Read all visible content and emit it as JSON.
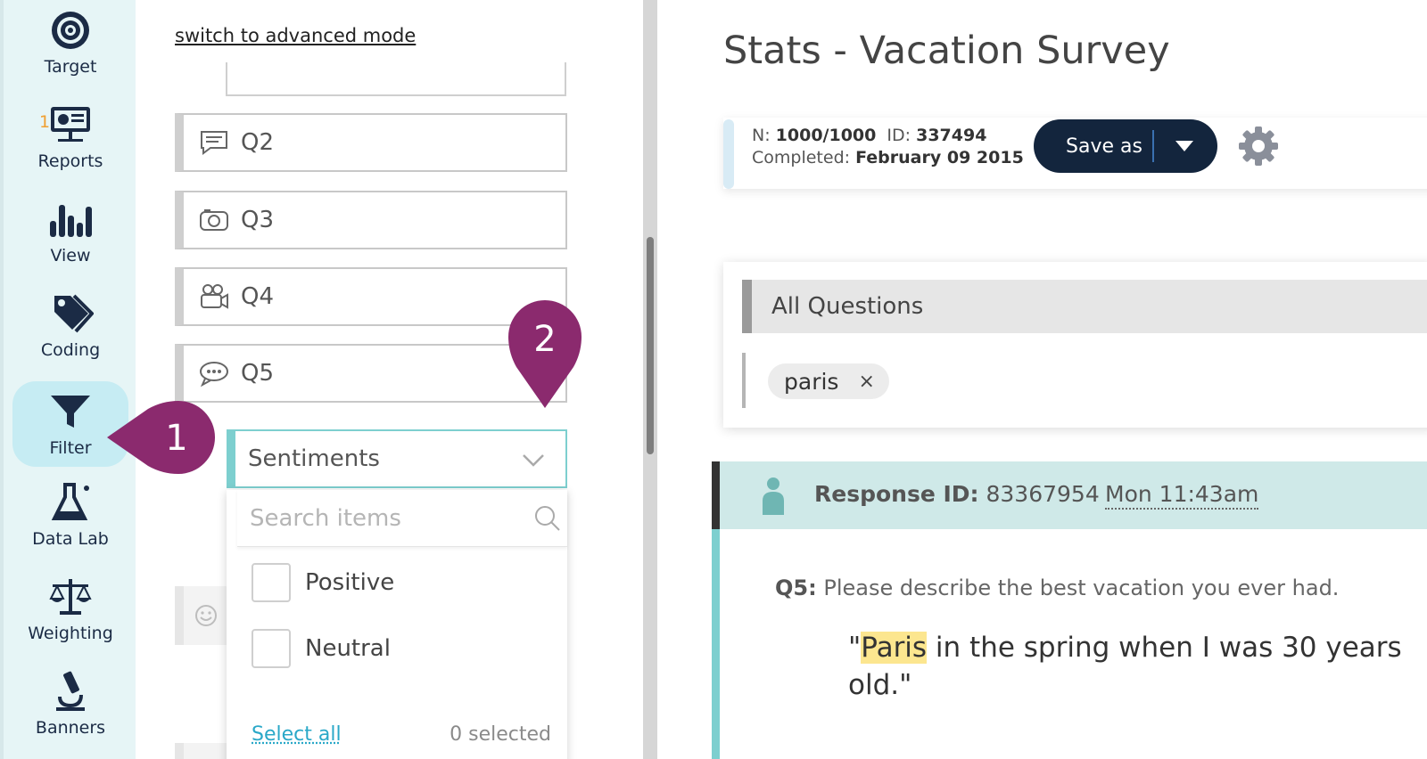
{
  "nav": {
    "items": [
      {
        "label": "Target",
        "icon": "target-icon"
      },
      {
        "label": "Reports",
        "icon": "presentation-board-icon",
        "badge": "1"
      },
      {
        "label": "View",
        "icon": "bar-chart-icon"
      },
      {
        "label": "Coding",
        "icon": "tags-icon"
      },
      {
        "label": "Filter",
        "icon": "funnel-icon",
        "active": true
      },
      {
        "label": "Data Lab",
        "icon": "flask-icon"
      },
      {
        "label": "Weighting",
        "icon": "scale-icon"
      },
      {
        "label": "Banners",
        "icon": "microscope-icon"
      }
    ],
    "active_color": "#c6ecf3"
  },
  "filter_panel": {
    "advanced_link": "switch to advanced mode",
    "questions": [
      {
        "label": "Q2",
        "icon": "speech-bubble-icon"
      },
      {
        "label": "Q3",
        "icon": "camera-icon"
      },
      {
        "label": "Q4",
        "icon": "video-camera-icon"
      },
      {
        "label": "Q5",
        "icon": "chat-dots-icon"
      }
    ],
    "sentiments_select": {
      "label": "Sentiments"
    },
    "dropdown": {
      "search_placeholder": "Search items",
      "options": [
        "Positive",
        "Neutral"
      ],
      "select_all": "Select all",
      "selected_count": "0 selected"
    }
  },
  "main": {
    "title": "Stats - Vacation Survey",
    "meta": {
      "n_label": "N:",
      "n_value": "1000/1000",
      "id_label": "ID:",
      "id_value": "337494",
      "completed_label": "Completed:",
      "completed_value": "February 09 2015"
    },
    "save_as": "Save as",
    "filter_box": {
      "header": "All Questions",
      "chip": "paris",
      "chip_remove": "×"
    },
    "response": {
      "id_label": "Response ID:",
      "id_value": "83367954",
      "time": "Mon 11:43am",
      "question_label": "Q5:",
      "question_text": "Please describe the best vacation you ever had.",
      "quote_open": "\"",
      "quote_highlight": "Paris",
      "quote_rest": " in the spring when I was 30 years old.\""
    }
  },
  "annotations": {
    "callout_1": "1",
    "callout_2": "2",
    "color": "#8b2a6e"
  },
  "colors": {
    "navy": "#13253d",
    "teal": "#7dcfcf",
    "highlight": "#fce68f",
    "link": "#2aa8c8"
  }
}
